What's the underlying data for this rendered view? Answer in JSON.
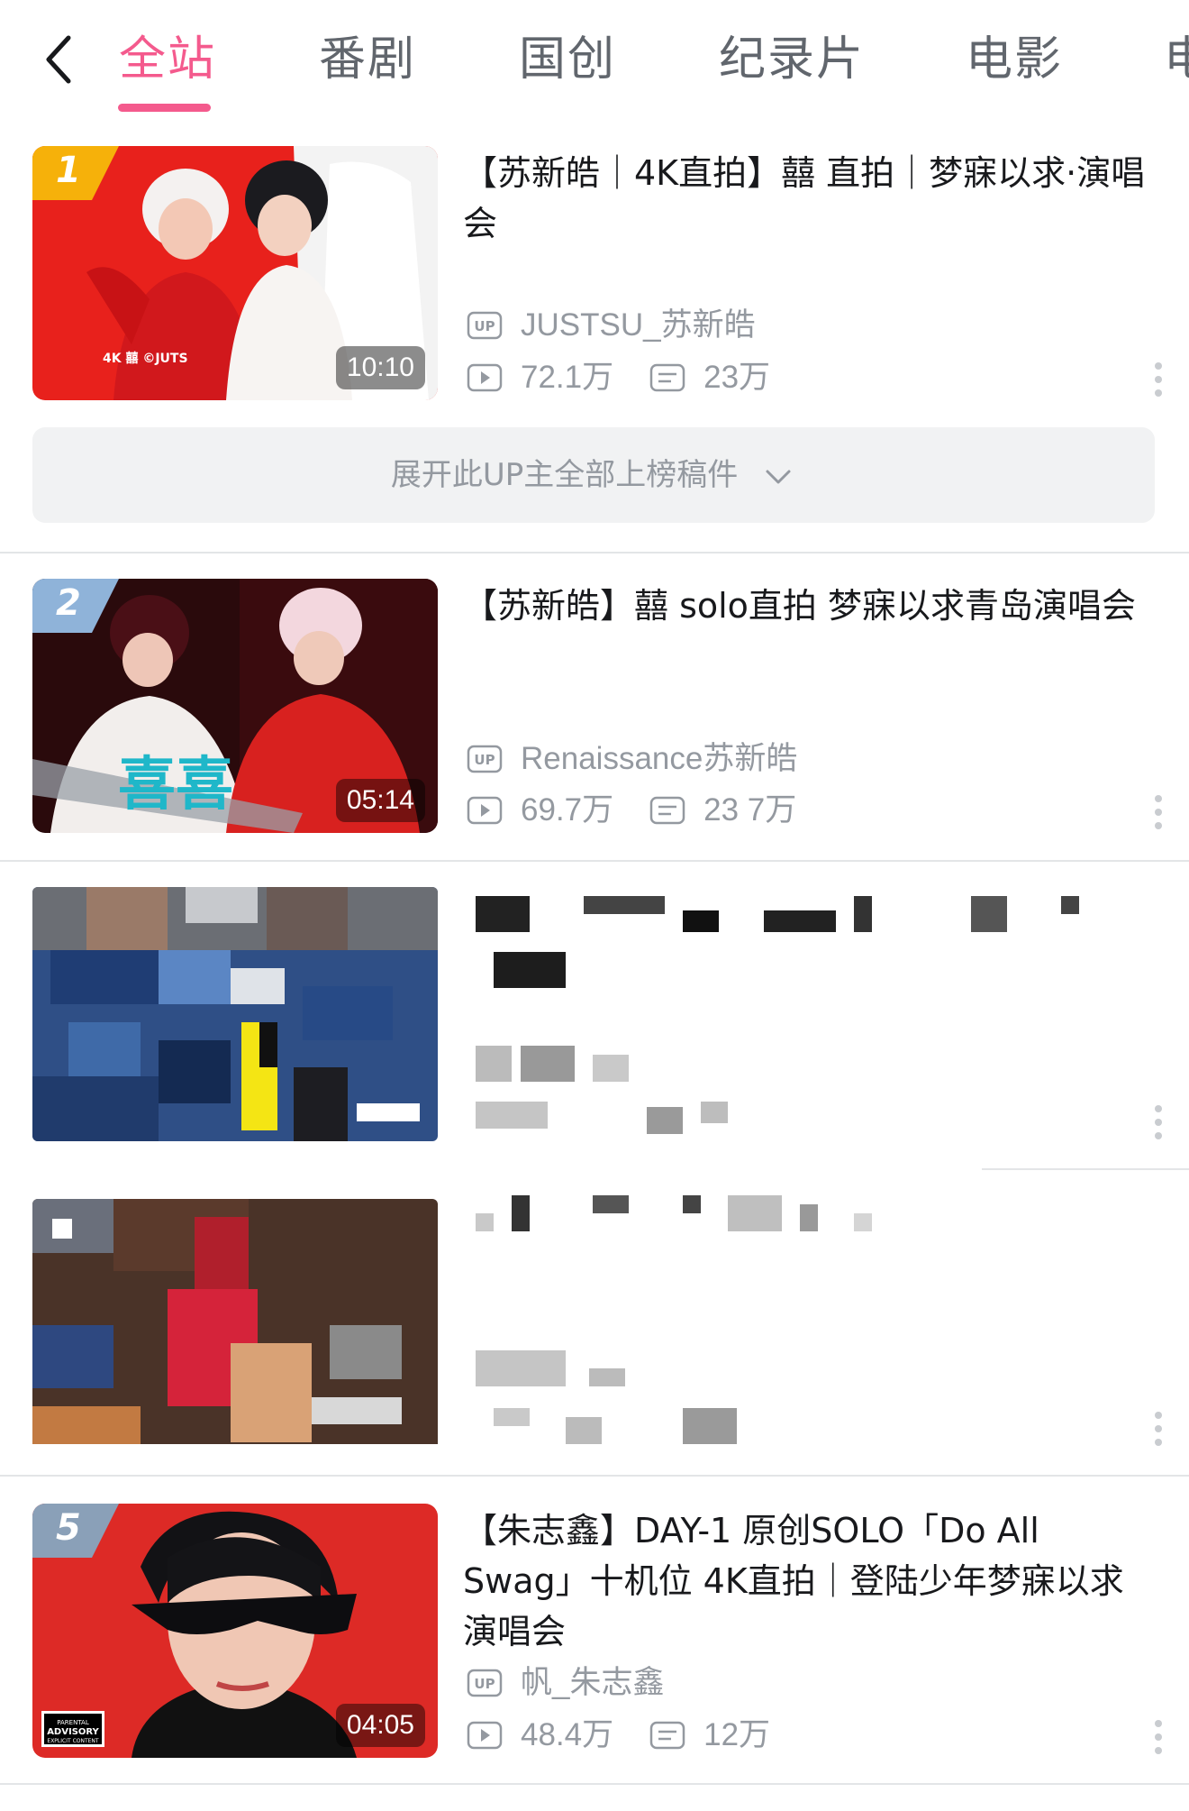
{
  "nav": {
    "tabs": [
      {
        "label": "全站",
        "active": true
      },
      {
        "label": "番剧"
      },
      {
        "label": "国创"
      },
      {
        "label": "纪录片"
      },
      {
        "label": "电影"
      },
      {
        "label": "电"
      }
    ],
    "accent_color": "#f45a8d",
    "back_icon": "chevron-left-icon"
  },
  "videos": [
    {
      "rank": "1",
      "title": "【苏新皓｜4K直拍】囍 直拍｜梦寐以求·演唱会",
      "up_name": "JUSTSU_苏新皓",
      "plays": "72.1万",
      "danmaku": "23万",
      "duration": "10:10",
      "thumb_text": "4K 囍 ©JUTS",
      "rank_color": "#f6b10a"
    },
    {
      "rank": "2",
      "title": "【苏新皓】囍 solo直拍 梦寐以求青岛演唱会",
      "up_name": "Renaissance苏新皓",
      "plays": "69.7万",
      "danmaku": "23 7万",
      "duration": "05:14",
      "thumb_text": "喜喜",
      "rank_color": "#8fb3d9"
    },
    {
      "rank": "5",
      "title": "【朱志鑫】DAY-1 原创SOLO「Do All Swag」十机位 4K直拍｜登陆少年梦寐以求演唱会",
      "up_name": "帆_朱志鑫",
      "plays": "48.4万",
      "danmaku": "12万",
      "duration": "04:05",
      "thumb_text": "PARENTAL ADVISORY EXPLICIT CONTENT",
      "rank_color": "#8aa0b8"
    }
  ],
  "expand_label": "展开此UP主全部上榜稿件",
  "up_badge": "UP",
  "icons": [
    "play-count-icon",
    "danmaku-icon",
    "up-badge-icon",
    "more-icon",
    "chevron-down-icon"
  ]
}
